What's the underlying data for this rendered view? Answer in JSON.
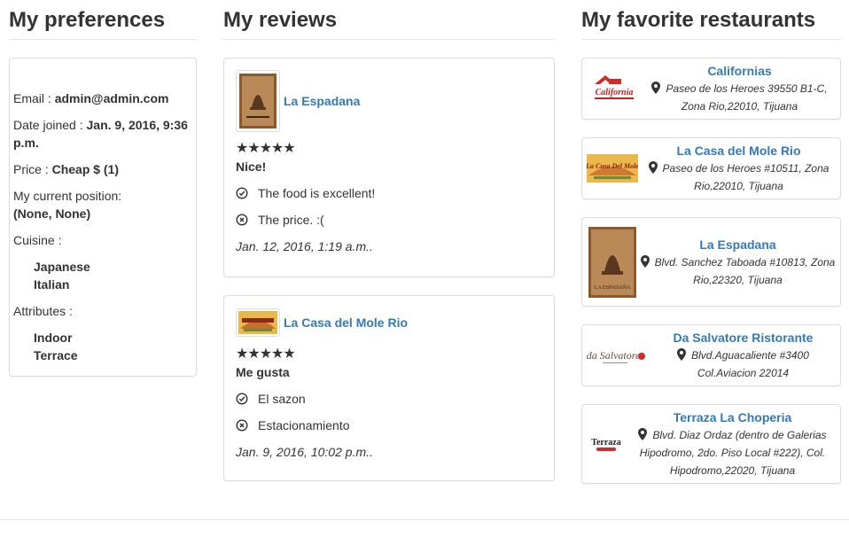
{
  "preferences": {
    "title": "My preferences",
    "email_label": "Email : ",
    "email_value": "admin@admin.com",
    "date_label": "Date joined : ",
    "date_value": "Jan. 9, 2016, 9:36 p.m.",
    "price_label": "Price : ",
    "price_value": "Cheap $ (1)",
    "position_label": "My current position:",
    "position_value": "(None, None)",
    "cuisine_label": "Cuisine :",
    "cuisines": [
      "Japanese",
      "Italian"
    ],
    "attributes_label": "Attributes :",
    "attributes": [
      "Indoor",
      "Terrace"
    ]
  },
  "reviews": {
    "title": "My reviews",
    "items": [
      {
        "restaurant": "La Espadana",
        "stars": "★★★★★",
        "rating": 5,
        "headline": "Nice!",
        "pro": "The food is excellent!",
        "con": "The price. :(",
        "date": "Jan. 12, 2016, 1:19 a.m.."
      },
      {
        "restaurant": "La Casa del Mole Rio",
        "stars": "★★★★★",
        "rating": 5,
        "headline": "Me gusta",
        "pro": "El sazon",
        "con": "Estacionamiento",
        "date": "Jan. 9, 2016, 10:02 p.m.."
      }
    ]
  },
  "favorites": {
    "title": "My favorite restaurants",
    "items": [
      {
        "name": "Californias",
        "address": "Paseo de los Heroes 39550 B1-C, Zona Rio,22010, Tijuana",
        "logo_text": "California"
      },
      {
        "name": "La Casa del Mole Rio",
        "address": "Paseo de los Heroes #10511, Zona Rio,22010, Tijuana",
        "logo_text": "La Casa Del Mole"
      },
      {
        "name": "La Espadana",
        "address": "Blvd. Sanchez Taboada #10813, Zona Rio,22320, Tijuana",
        "logo_text": "LA ESPADAÑA"
      },
      {
        "name": "Da Salvatore Ristorante",
        "address": "Blvd.Aguacaliente #3400 Col.Aviacion 22014",
        "logo_text": "da Salvatore"
      },
      {
        "name": "Terraza La Choperia",
        "address": "Blvd. Diaz Ordaz (dentro de Galerias Hipodromo, 2do. Piso Local #222), Col. Hipodromo,22020, Tijuana",
        "logo_text": "Terraza"
      }
    ]
  },
  "colors": {
    "link": "#337ab7",
    "text": "#333333",
    "border": "#dddddd"
  }
}
